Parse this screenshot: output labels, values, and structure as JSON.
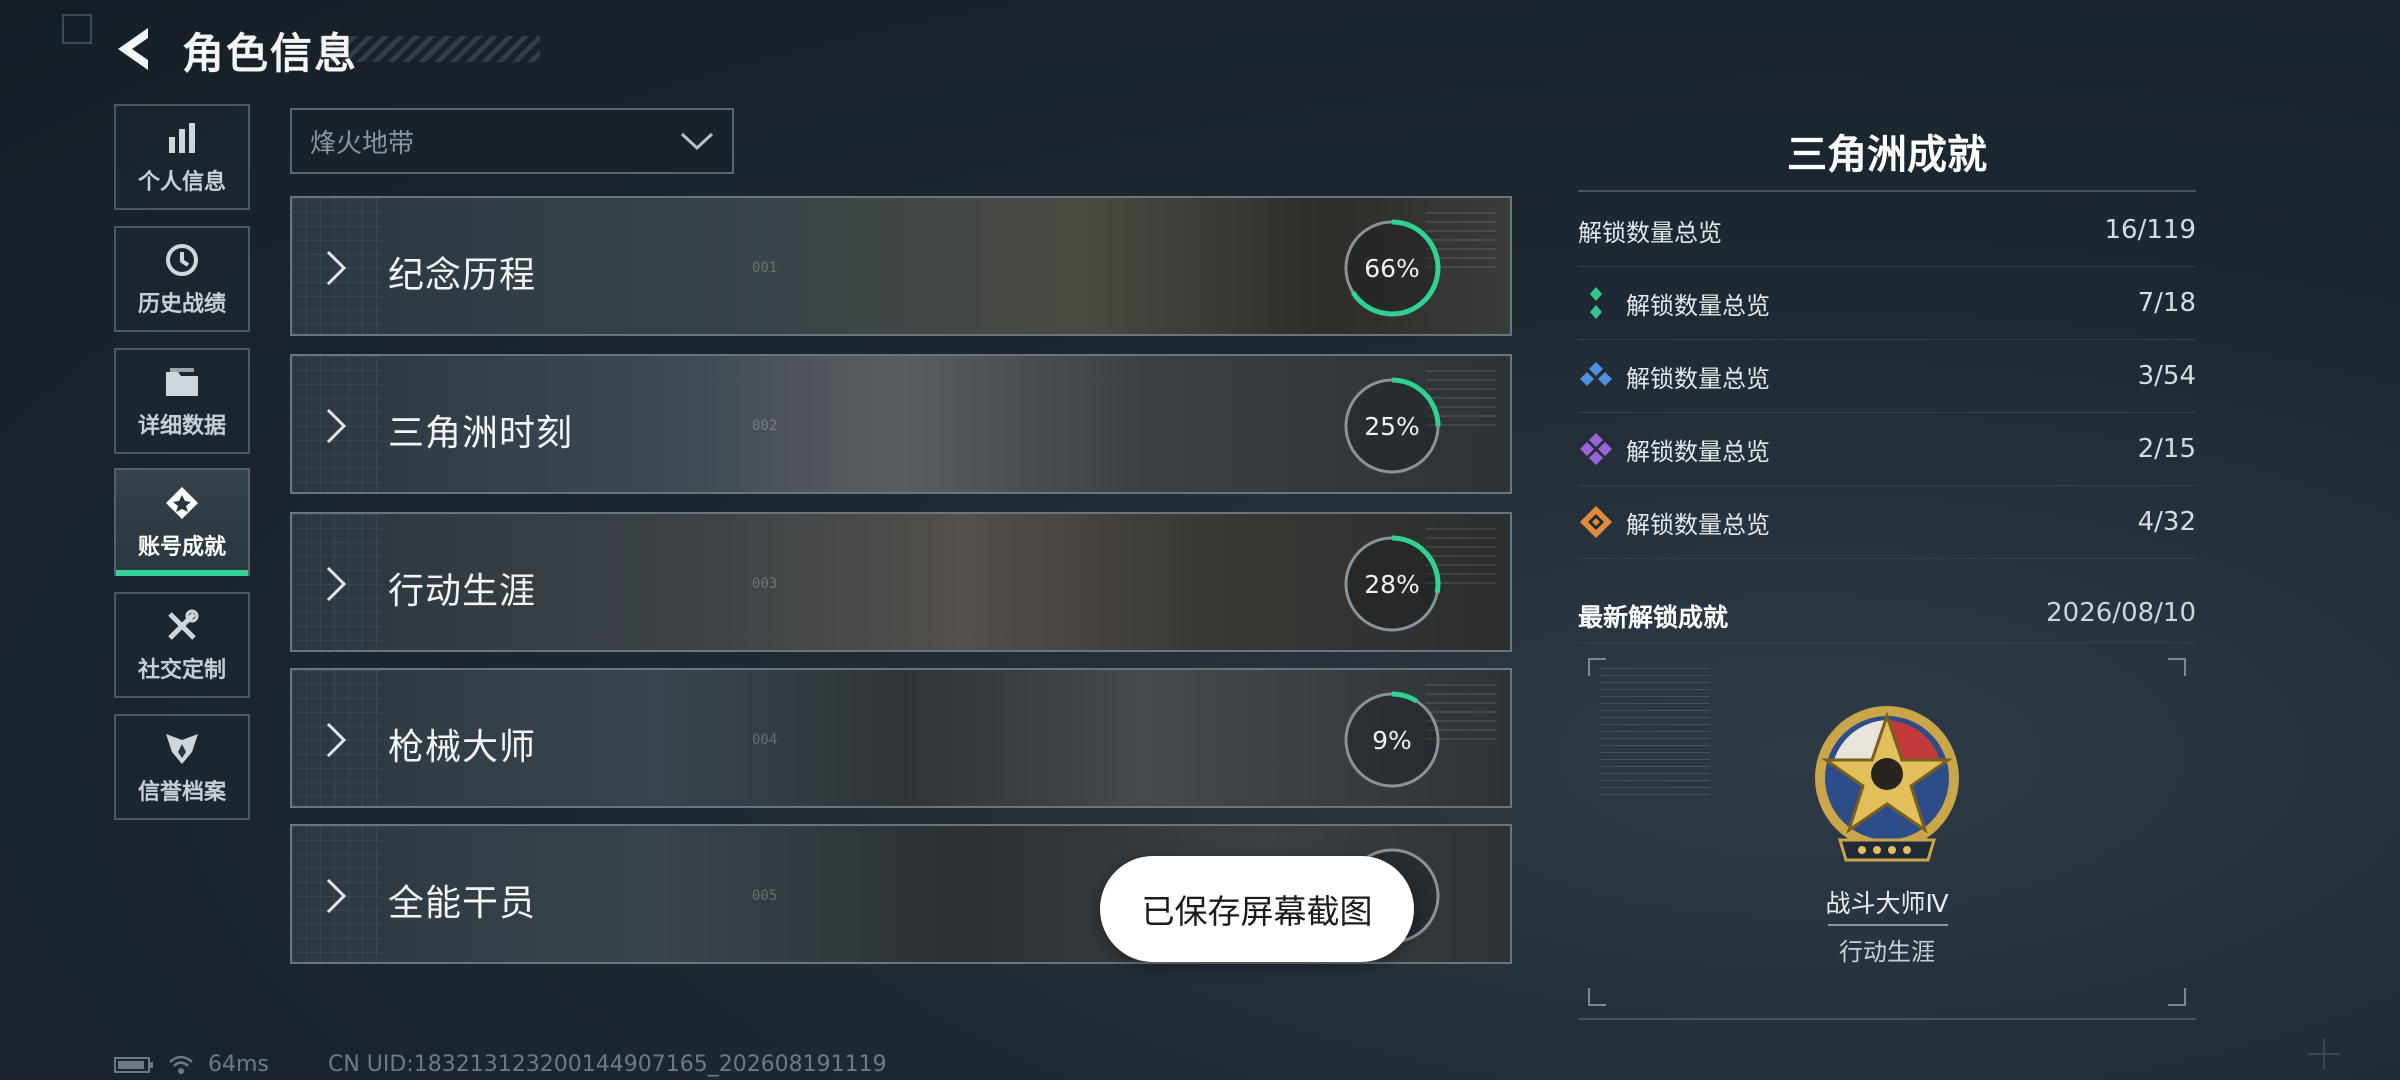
{
  "header": {
    "title": "角色信息"
  },
  "sidebar": {
    "items": [
      {
        "label": "个人信息",
        "icon": "bar-chart-icon"
      },
      {
        "label": "历史战绩",
        "icon": "history-clock-icon"
      },
      {
        "label": "详细数据",
        "icon": "folder-icon"
      },
      {
        "label": "账号成就",
        "icon": "achievement-badge-icon",
        "active": true
      },
      {
        "label": "社交定制",
        "icon": "wrench-tools-icon"
      },
      {
        "label": "信誉档案",
        "icon": "shield-emblem-icon"
      }
    ]
  },
  "mode_dropdown": {
    "value": "烽火地带"
  },
  "categories": [
    {
      "name": "纪念历程",
      "progress": 0.66,
      "progress_label": "66%",
      "num": "001"
    },
    {
      "name": "三角洲时刻",
      "progress": 0.25,
      "progress_label": "25%",
      "num": "002"
    },
    {
      "name": "行动生涯",
      "progress": 0.28,
      "progress_label": "28%",
      "num": "003"
    },
    {
      "name": "枪械大师",
      "progress": 0.09,
      "progress_label": "9%",
      "num": "004"
    },
    {
      "name": "全能干员",
      "progress": null,
      "progress_label": "",
      "num": "005"
    }
  ],
  "toast": {
    "text": "已保存屏幕截图"
  },
  "achievements_panel": {
    "title": "三角洲成就",
    "overview": {
      "label": "解锁数量总览",
      "value": "16/119"
    },
    "tiers": [
      {
        "label": "解锁数量总览",
        "value": "7/18",
        "color": "#35c48a"
      },
      {
        "label": "解锁数量总览",
        "value": "3/54",
        "color": "#4f8fe0"
      },
      {
        "label": "解锁数量总览",
        "value": "2/15",
        "color": "#9a63d8"
      },
      {
        "label": "解锁数量总览",
        "value": "4/32",
        "color": "#e08a3c"
      }
    ],
    "latest": {
      "label": "最新解锁成就",
      "date": "2026/08/10",
      "medal_name": "战斗大师Ⅳ",
      "medal_category": "行动生涯"
    }
  },
  "status_bar": {
    "ping": "64ms",
    "uid": "CN UID:18321312320014490716​5_202608191119"
  },
  "colors": {
    "accent": "#34d39a",
    "progress": "#2fd38f"
  }
}
